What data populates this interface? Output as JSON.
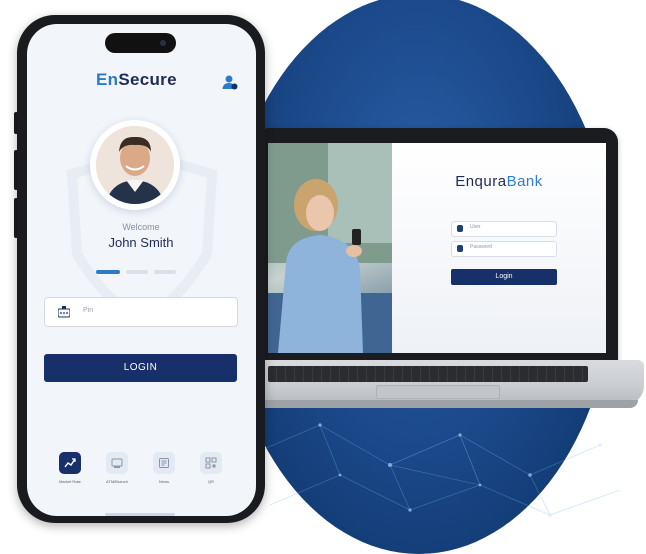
{
  "colors": {
    "brand_navy": "#17306a",
    "brand_blue": "#2d7ac8",
    "background_blue": "#1c4a8c"
  },
  "phone": {
    "logo_prefix": "En",
    "logo_suffix": "Secure",
    "welcome_text": "Welcome",
    "user_name": "John Smith",
    "pin_placeholder": "Pin",
    "login_label": "LOGIN",
    "tabs": [
      {
        "label": "Market Rate",
        "icon": "chart-icon",
        "active": true
      },
      {
        "label": "ATM/Branch",
        "icon": "atm-icon",
        "active": false
      },
      {
        "label": "News",
        "icon": "news-icon",
        "active": false
      },
      {
        "label": "QR",
        "icon": "qr-icon",
        "active": false
      }
    ],
    "carousel": {
      "pages": 3,
      "current": 1
    }
  },
  "laptop": {
    "brand_prefix": "Enqura",
    "brand_suffix": "Bank",
    "user_placeholder": "User",
    "password_placeholder": "Password",
    "login_label": "Login"
  }
}
